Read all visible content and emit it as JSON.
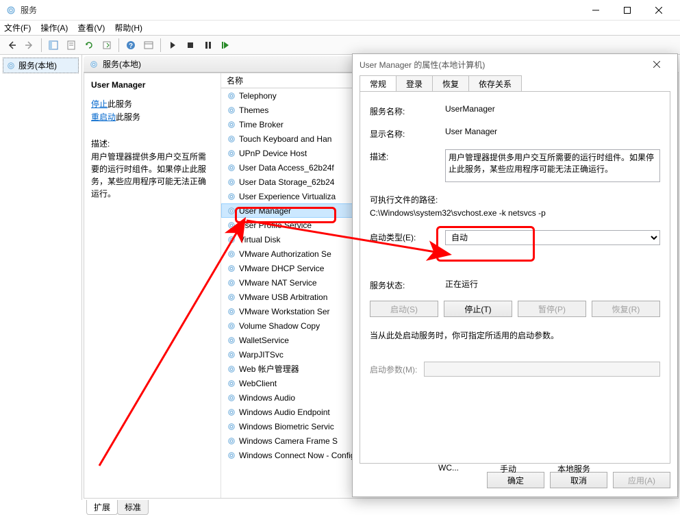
{
  "titlebar": {
    "title": "服务"
  },
  "menubar": [
    "文件(F)",
    "操作(A)",
    "查看(V)",
    "帮助(H)"
  ],
  "leftpane": {
    "node": "服务(本地)"
  },
  "rightpane": {
    "header": "服务(本地)",
    "detail": {
      "title": "User Manager",
      "stop_prefix": "停止",
      "stop_suffix": "此服务",
      "restart_prefix": "重启动",
      "restart_suffix": "此服务",
      "desc_label": "描述:",
      "desc": "用户管理器提供多用户交互所需要的运行时组件。如果停止此服务，某些应用程序可能无法正确运行。"
    },
    "list_header": "名称",
    "services": [
      "Telephony",
      "Themes",
      "Time Broker",
      "Touch Keyboard and Han",
      "UPnP Device Host",
      "User Data Access_62b24f",
      "User Data Storage_62b24",
      "User Experience Virtualiza",
      "User Manager",
      "User Profile Service",
      "Virtual Disk",
      "VMware Authorization Se",
      "VMware DHCP Service",
      "VMware NAT Service",
      "VMware USB Arbitration ",
      "VMware Workstation Ser",
      "Volume Shadow Copy",
      "WalletService",
      "WarpJITSvc",
      "Web 帐户管理器",
      "WebClient",
      "Windows Audio",
      "Windows Audio Endpoint",
      "Windows Biometric Servic",
      "Windows Camera Frame S",
      "Windows Connect Now - Config Registrar"
    ],
    "selected_index": 8,
    "extra_row": {
      "col1": "WC...",
      "col2": "手动",
      "col3": "本地服务"
    }
  },
  "tabs_bottom": {
    "active": "扩展",
    "inactive": "标准"
  },
  "dialog": {
    "title": "User Manager 的属性(本地计算机)",
    "tabs": [
      "常规",
      "登录",
      "恢复",
      "依存关系"
    ],
    "active_tab": 0,
    "fields": {
      "svc_name_lbl": "服务名称:",
      "svc_name": "UserManager",
      "display_lbl": "显示名称:",
      "display": "User Manager",
      "desc_lbl": "描述:",
      "desc": "用户管理器提供多用户交互所需要的运行时组件。如果停止此服务，某些应用程序可能无法正确运行。",
      "exe_lbl": "可执行文件的路径:",
      "exe": "C:\\Windows\\system32\\svchost.exe -k netsvcs -p",
      "startup_lbl": "启动类型(E):",
      "startup_value": "自动",
      "status_lbl": "服务状态:",
      "status": "正在运行",
      "btn_start": "启动(S)",
      "btn_stop": "停止(T)",
      "btn_pause": "暂停(P)",
      "btn_resume": "恢复(R)",
      "hint": "当从此处启动服务时，你可指定所适用的启动参数。",
      "startparam_lbl": "启动参数(M):"
    },
    "buttons": {
      "ok": "确定",
      "cancel": "取消",
      "apply": "应用(A)"
    }
  }
}
